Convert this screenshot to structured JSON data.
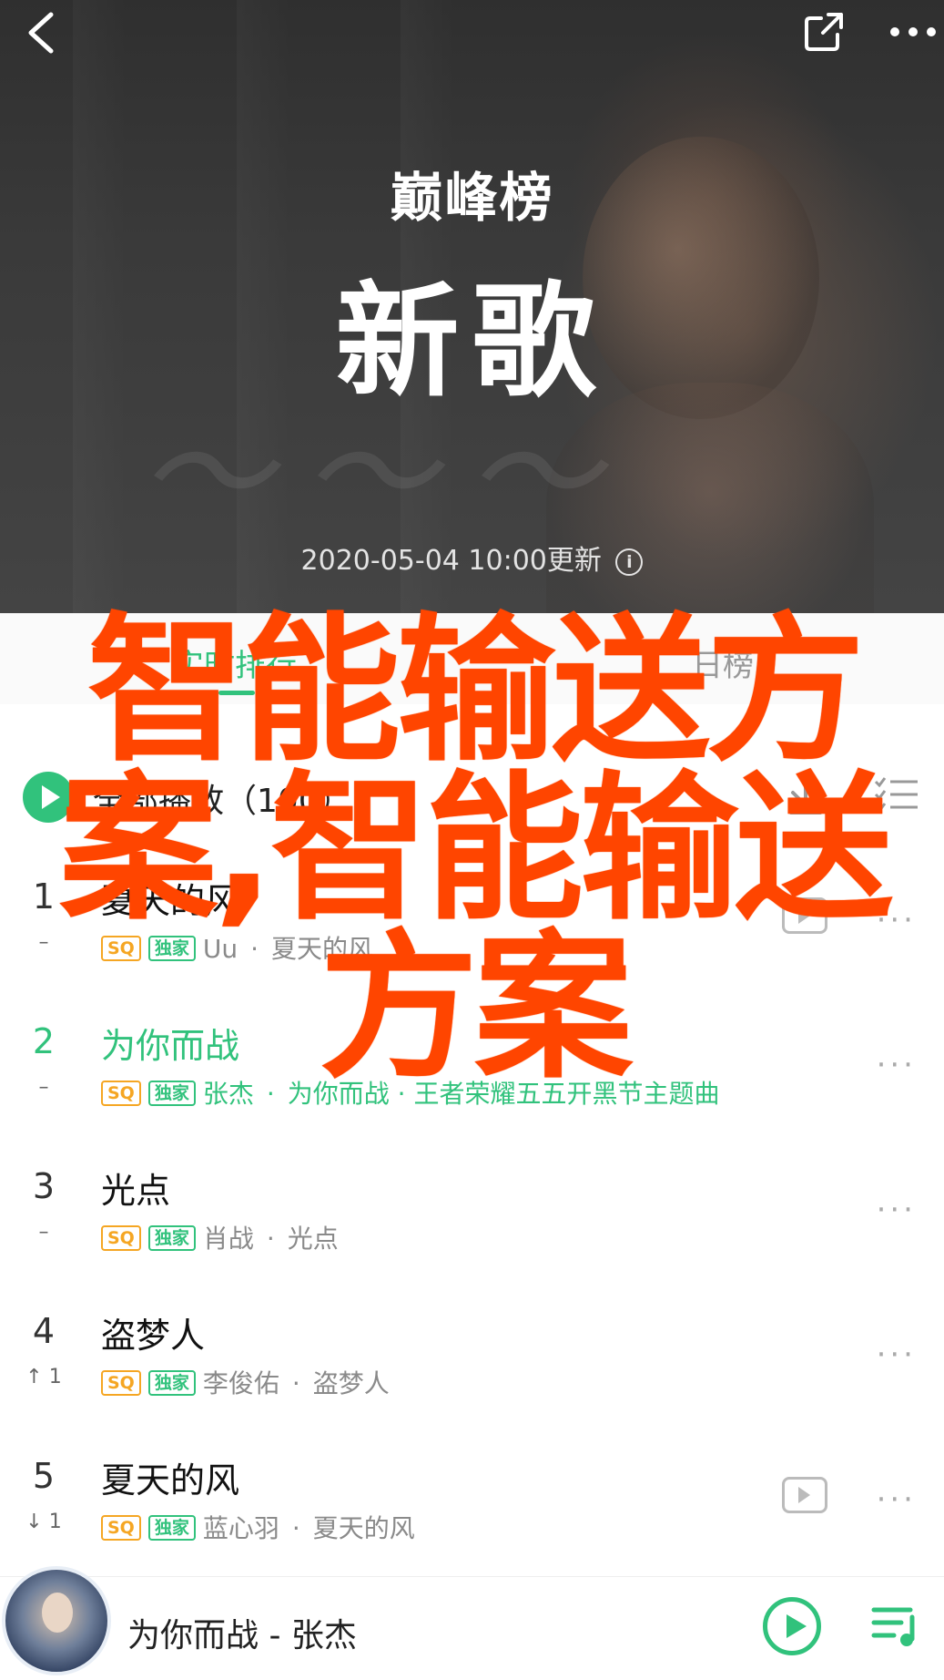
{
  "header": {
    "logo_text": "巅峰榜",
    "title": "新歌",
    "update_text": "2020-05-04  10:00更新"
  },
  "tabs": [
    {
      "label": "实时排行",
      "active": true
    },
    {
      "label": "日榜",
      "active": false
    }
  ],
  "toolbar": {
    "play_all_label": "全部播放（100）"
  },
  "songs": [
    {
      "rank": "1",
      "trend": "–",
      "title": "夏天的风",
      "artist": "Uu",
      "album": "夏天的风",
      "has_video": true
    },
    {
      "rank": "2",
      "trend": "–",
      "title": "为你而战",
      "artist": "张杰",
      "album": "为你而战 · 王者荣耀五五开黑节主题曲",
      "has_video": false,
      "playing": true
    },
    {
      "rank": "3",
      "trend": "–",
      "title": "光点",
      "artist": "肖战",
      "album": "光点",
      "has_video": false
    },
    {
      "rank": "4",
      "trend": "↑ 1",
      "title": "盗梦人",
      "artist": "李俊佑",
      "album": "盗梦人",
      "has_video": false
    },
    {
      "rank": "5",
      "trend": "↓ 1",
      "title": "夏天的风",
      "artist": "蓝心羽",
      "album": "夏天的风",
      "has_video": true
    }
  ],
  "badges": {
    "sq": "SQ",
    "exclusive": "独家"
  },
  "separator": "·",
  "overlay_text": "智能输送方案,智能输送方案",
  "player": {
    "now_playing": "为你而战 - 张杰"
  },
  "colors": {
    "accent": "#31c27c",
    "overlay": "#ff4500",
    "sq_badge": "#f5a623"
  },
  "icons": [
    "back-icon",
    "share-icon",
    "more-icon",
    "info-icon",
    "play-all-icon",
    "download-icon",
    "multi-select-icon",
    "video-icon",
    "play-icon",
    "playlist-icon"
  ]
}
